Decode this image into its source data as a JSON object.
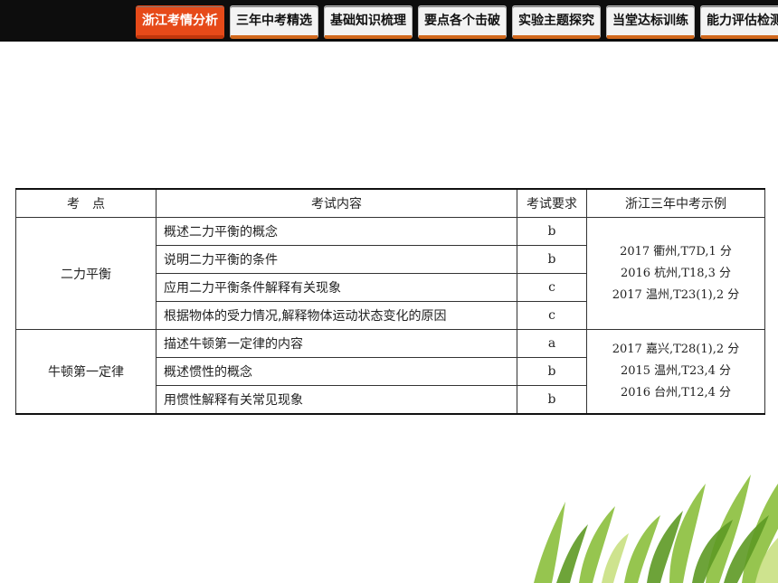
{
  "nav": {
    "tabs": [
      {
        "label": "浙江考情分析",
        "active": true
      },
      {
        "label": "三年中考精选",
        "active": false
      },
      {
        "label": "基础知识梳理",
        "active": false
      },
      {
        "label": "要点各个击破",
        "active": false
      },
      {
        "label": "实验主题探究",
        "active": false
      },
      {
        "label": "当堂达标训练",
        "active": false
      },
      {
        "label": "能力评估检测",
        "active": false
      }
    ],
    "accent_color": "#e64a19"
  },
  "table": {
    "headers": {
      "topic": "考　点",
      "content": "考试内容",
      "requirement": "考试要求",
      "examples": "浙江三年中考示例"
    },
    "groups": [
      {
        "topic": "二力平衡",
        "rows": [
          {
            "content": "概述二力平衡的概念",
            "requirement": "b"
          },
          {
            "content": "说明二力平衡的条件",
            "requirement": "b"
          },
          {
            "content": "应用二力平衡条件解释有关现象",
            "requirement": "c"
          },
          {
            "content": "根据物体的受力情况,解释物体运动状态变化的原因",
            "requirement": "c"
          }
        ],
        "examples": [
          "2017 衢州,T7D,1 分",
          "2016 杭州,T18,3 分",
          "2017 温州,T23(1),2 分"
        ]
      },
      {
        "topic": "牛顿第一定律",
        "rows": [
          {
            "content": "描述牛顿第一定律的内容",
            "requirement": "a"
          },
          {
            "content": "概述惯性的概念",
            "requirement": "b"
          },
          {
            "content": "用惯性解释有关常见现象",
            "requirement": "b"
          }
        ],
        "examples": [
          "2017 嘉兴,T28(1),2 分",
          "2015 温州,T23,4 分",
          "2016 台州,T12,4 分"
        ]
      }
    ]
  }
}
